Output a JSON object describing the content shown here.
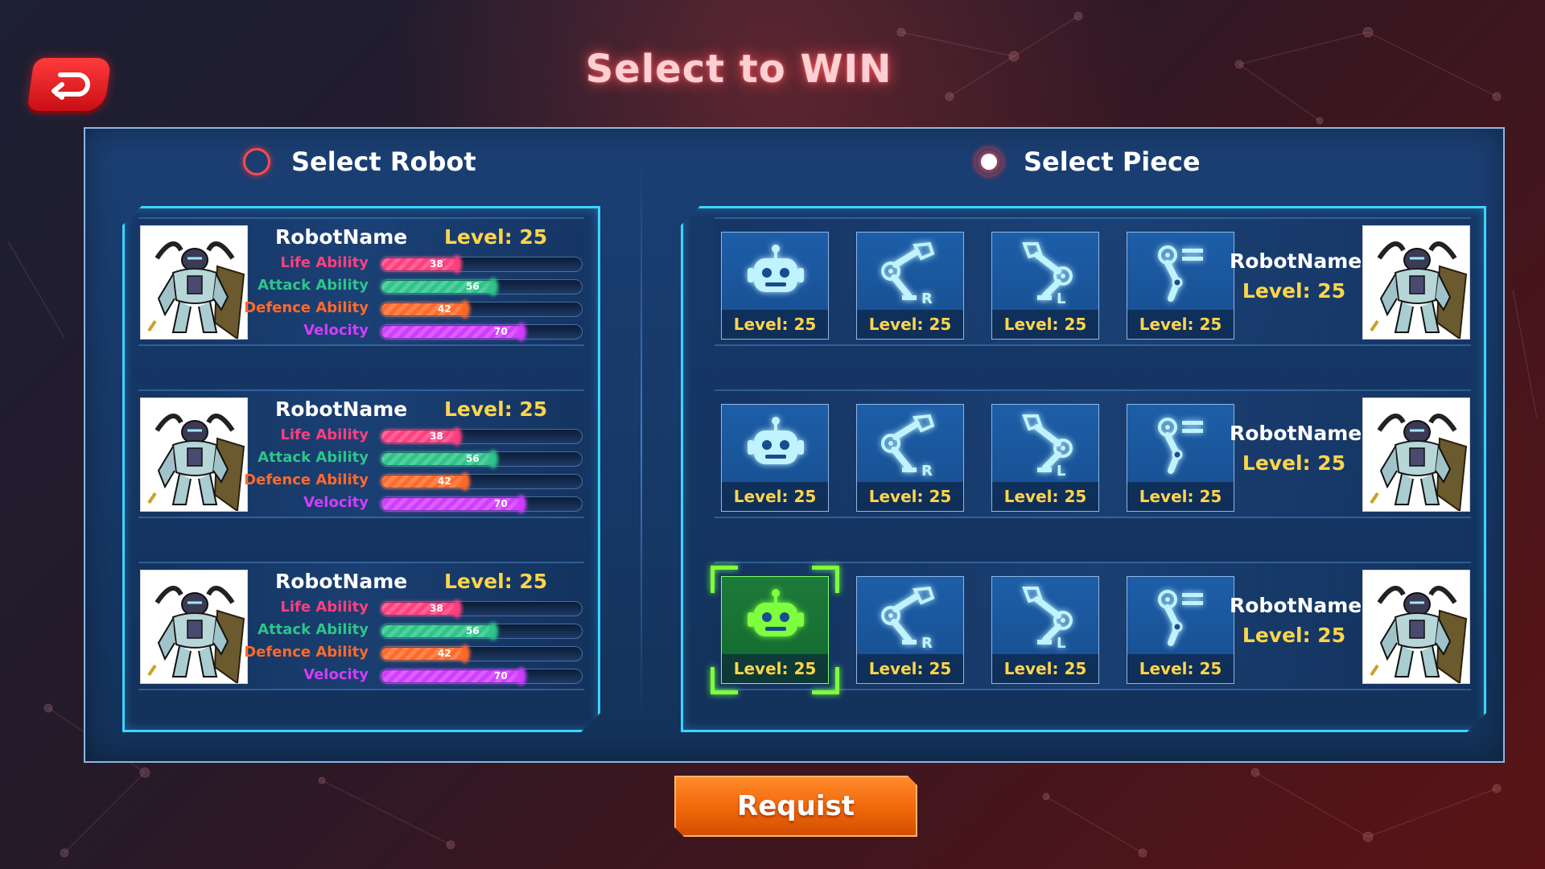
{
  "title": "Select to WIN",
  "back_icon": "back-arrow-icon",
  "left_section": {
    "label": "Select Robot",
    "selected": false
  },
  "right_section": {
    "label": "Select Piece",
    "selected": true
  },
  "colors": {
    "life": "#ff3f7f",
    "attack": "#2ec48a",
    "defence": "#ff6a2a",
    "velocity": "#d23cff",
    "level": "#ffd54a",
    "frame": "#3fd3ff",
    "selected": "#7dff3e"
  },
  "robots": [
    {
      "name": "RobotName",
      "level": "Level: 25",
      "stats": [
        {
          "label": "Life Ability",
          "value": "38",
          "fraction": 0.38
        },
        {
          "label": "Attack Ability",
          "value": "56",
          "fraction": 0.56
        },
        {
          "label": "Defence Ability",
          "value": "42",
          "fraction": 0.42
        },
        {
          "label": "Velocity",
          "value": "70",
          "fraction": 0.7
        }
      ]
    },
    {
      "name": "RobotName",
      "level": "Level: 25",
      "stats": [
        {
          "label": "Life Ability",
          "value": "38",
          "fraction": 0.38
        },
        {
          "label": "Attack Ability",
          "value": "56",
          "fraction": 0.56
        },
        {
          "label": "Defence Ability",
          "value": "42",
          "fraction": 0.42
        },
        {
          "label": "Velocity",
          "value": "70",
          "fraction": 0.7
        }
      ]
    },
    {
      "name": "RobotName",
      "level": "Level: 25",
      "stats": [
        {
          "label": "Life Ability",
          "value": "38",
          "fraction": 0.38
        },
        {
          "label": "Attack Ability",
          "value": "56",
          "fraction": 0.56
        },
        {
          "label": "Defence Ability",
          "value": "42",
          "fraction": 0.42
        },
        {
          "label": "Velocity",
          "value": "70",
          "fraction": 0.7
        }
      ]
    }
  ],
  "piece_rows": [
    {
      "robot_name": "RobotName",
      "robot_level": "Level: 25",
      "pieces": [
        {
          "icon": "robot-head-icon",
          "level": "Level: 25",
          "selected": false
        },
        {
          "icon": "right-arm-icon",
          "level": "Level: 25",
          "selected": false
        },
        {
          "icon": "left-arm-icon",
          "level": "Level: 25",
          "selected": false
        },
        {
          "icon": "leg-icon",
          "level": "Level: 25",
          "selected": false
        }
      ]
    },
    {
      "robot_name": "RobotName",
      "robot_level": "Level: 25",
      "pieces": [
        {
          "icon": "robot-head-icon",
          "level": "Level: 25",
          "selected": false
        },
        {
          "icon": "right-arm-icon",
          "level": "Level: 25",
          "selected": false
        },
        {
          "icon": "left-arm-icon",
          "level": "Level: 25",
          "selected": false
        },
        {
          "icon": "leg-icon",
          "level": "Level: 25",
          "selected": false
        }
      ]
    },
    {
      "robot_name": "RobotName",
      "robot_level": "Level: 25",
      "pieces": [
        {
          "icon": "robot-head-icon",
          "level": "Level: 25",
          "selected": true
        },
        {
          "icon": "right-arm-icon",
          "level": "Level: 25",
          "selected": false
        },
        {
          "icon": "left-arm-icon",
          "level": "Level: 25",
          "selected": false
        },
        {
          "icon": "leg-icon",
          "level": "Level: 25",
          "selected": false
        }
      ]
    }
  ],
  "request_button": "Requist"
}
